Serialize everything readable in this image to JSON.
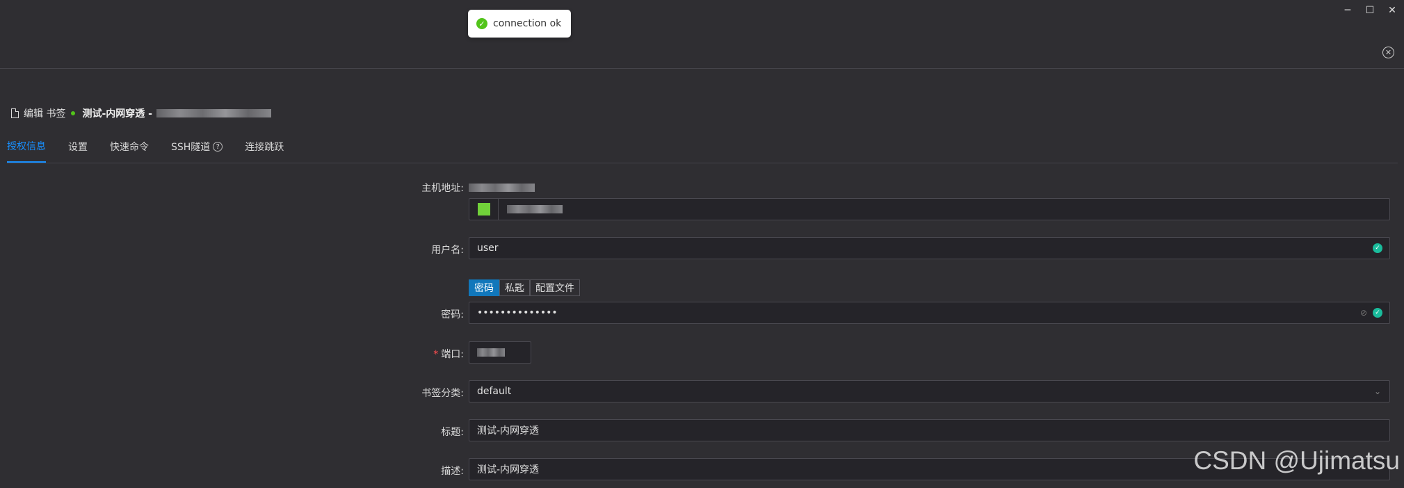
{
  "window": {
    "minimize_icon": "minimize-icon",
    "maximize_icon": "maximize-icon",
    "close_icon": "close-icon"
  },
  "toast": {
    "message": "connection ok",
    "icon": "check-circle-icon",
    "color": "#52c41a"
  },
  "header": {
    "prefix": "编辑 书签",
    "bookmark_name": "测试-内网穿透 -"
  },
  "tabs": [
    {
      "label": "授权信息",
      "active": true
    },
    {
      "label": "设置"
    },
    {
      "label": "快速命令"
    },
    {
      "label": "SSH隧道"
    },
    {
      "label": "连接跳跃"
    }
  ],
  "form": {
    "host": {
      "label": "主机地址:"
    },
    "username": {
      "label": "用户名:",
      "value": "user"
    },
    "auth_types": [
      "密码",
      "私匙",
      "配置文件"
    ],
    "password": {
      "label": "密码:",
      "value": "••••••••••••••"
    },
    "port": {
      "label": "端口:",
      "required_mark": "*"
    },
    "category": {
      "label": "书签分类:",
      "value": "default"
    },
    "title": {
      "label": "标题:",
      "value": "测试-内网穿透"
    },
    "description": {
      "label": "描述:",
      "value": "测试-内网穿透"
    }
  },
  "colors": {
    "accent": "#1890ff",
    "success": "#52c41a",
    "swatch": "#71d13a",
    "segment_active": "#1177bb"
  },
  "watermark": "CSDN @Ujimatsu"
}
